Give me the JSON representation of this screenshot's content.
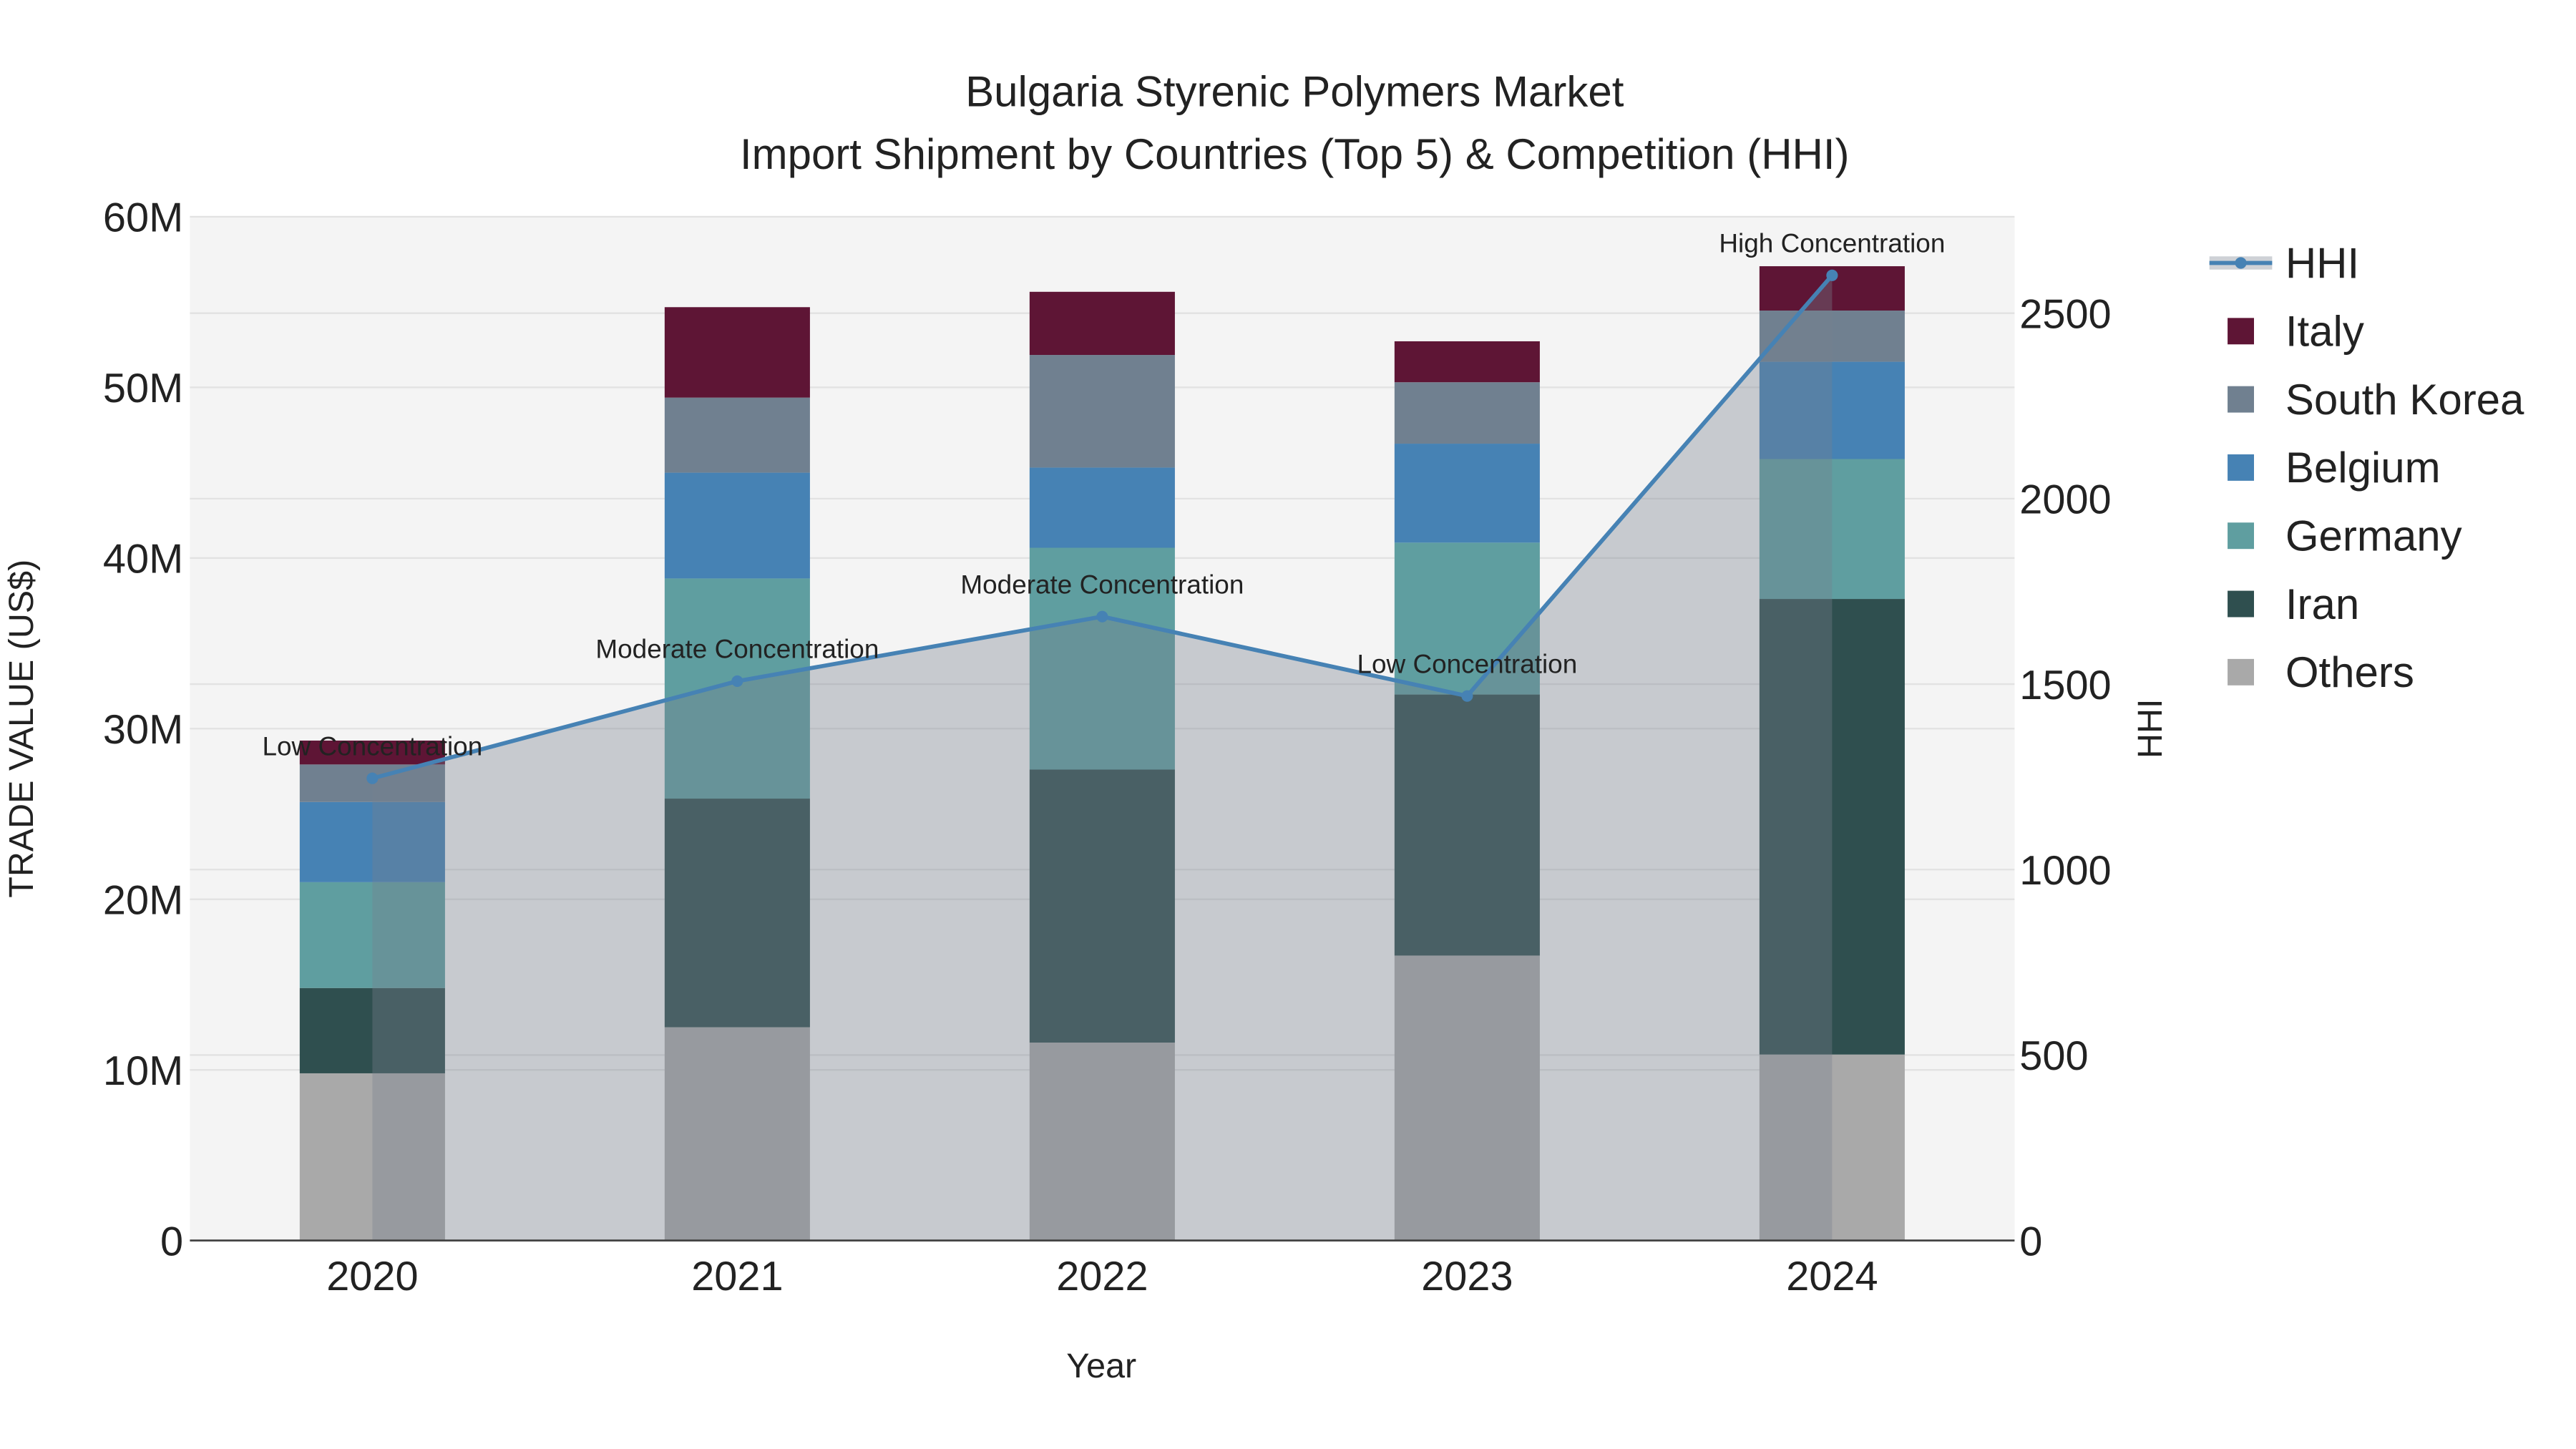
{
  "chart_data": {
    "type": "bar",
    "title": "Bulgaria Styrenic Polymers Market",
    "subtitle": "Import Shipment by Countries (Top 5) & Competition (HHI)",
    "xlabel": "Year",
    "ylabel": "TRADE VALUE (US$)",
    "y2label": "HHI",
    "categories": [
      "2020",
      "2021",
      "2022",
      "2023",
      "2024"
    ],
    "ylim": [
      0,
      60000000
    ],
    "y_ticks": [
      0,
      10000000,
      20000000,
      30000000,
      40000000,
      50000000,
      60000000
    ],
    "y_tick_labels": [
      "0",
      "10M",
      "20M",
      "30M",
      "40M",
      "50M",
      "60M"
    ],
    "y2lim": [
      0,
      2760
    ],
    "y2_ticks": [
      0,
      500,
      1000,
      1500,
      2000,
      2500
    ],
    "y2_tick_labels": [
      "0",
      "500",
      "1000",
      "1500",
      "2000",
      "2500"
    ],
    "stacked": true,
    "grid": true,
    "legend_position": "right",
    "series": [
      {
        "name": "Others",
        "color": "#a9a9a9",
        "values": [
          9800000,
          12500000,
          11600000,
          16700000,
          10900000
        ]
      },
      {
        "name": "Iran",
        "color": "#2f4f4f",
        "values": [
          5000000,
          13400000,
          16000000,
          15300000,
          26700000
        ]
      },
      {
        "name": "Germany",
        "color": "#5f9ea0",
        "values": [
          6200000,
          12900000,
          13000000,
          8900000,
          8200000
        ]
      },
      {
        "name": "Belgium",
        "color": "#4682b4",
        "values": [
          4700000,
          6200000,
          4700000,
          5800000,
          5700000
        ]
      },
      {
        "name": "South Korea",
        "color": "#708090",
        "values": [
          2200000,
          4400000,
          6600000,
          3600000,
          3000000
        ]
      },
      {
        "name": "Italy",
        "color": "#5e1535",
        "values": [
          1400000,
          5300000,
          3700000,
          2400000,
          2600000
        ]
      }
    ],
    "hhi": {
      "name": "HHI",
      "color": "#4682b4",
      "values": [
        1246,
        1508,
        1682,
        1468,
        2602
      ],
      "annotations": [
        "Low Concentration",
        "Moderate Concentration",
        "Moderate Concentration",
        "Low Concentration",
        "High Concentration"
      ]
    },
    "legend": [
      "HHI",
      "Italy",
      "South Korea",
      "Belgium",
      "Germany",
      "Iran",
      "Others"
    ]
  }
}
